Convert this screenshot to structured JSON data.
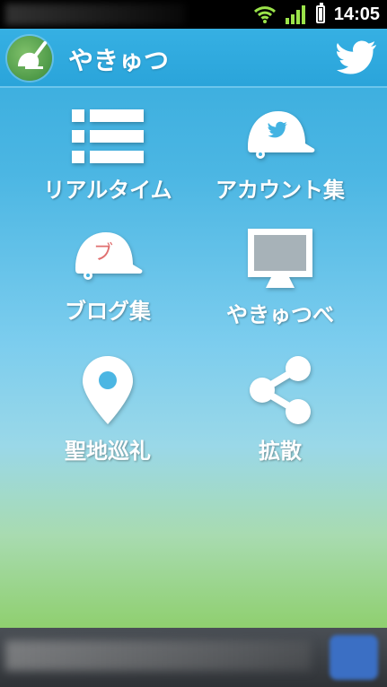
{
  "status": {
    "time": "14:05"
  },
  "app": {
    "title": "やきゅつ"
  },
  "menu": [
    {
      "label": "リアルタイム",
      "icon": "list-icon"
    },
    {
      "label": "アカウント集",
      "icon": "twitter-cap-icon"
    },
    {
      "label": "ブログ集",
      "icon": "blog-cap-icon",
      "icon_text": "ブ"
    },
    {
      "label": "やきゅつべ",
      "icon": "monitor-icon"
    },
    {
      "label": "聖地巡礼",
      "icon": "map-pin-icon"
    },
    {
      "label": "拡散",
      "icon": "share-icon"
    }
  ],
  "colors": {
    "accent": "#2aa4da",
    "sky_top": "#31a9dc",
    "grass_bottom": "#7ec95c",
    "blog_mark": "#e07070"
  }
}
